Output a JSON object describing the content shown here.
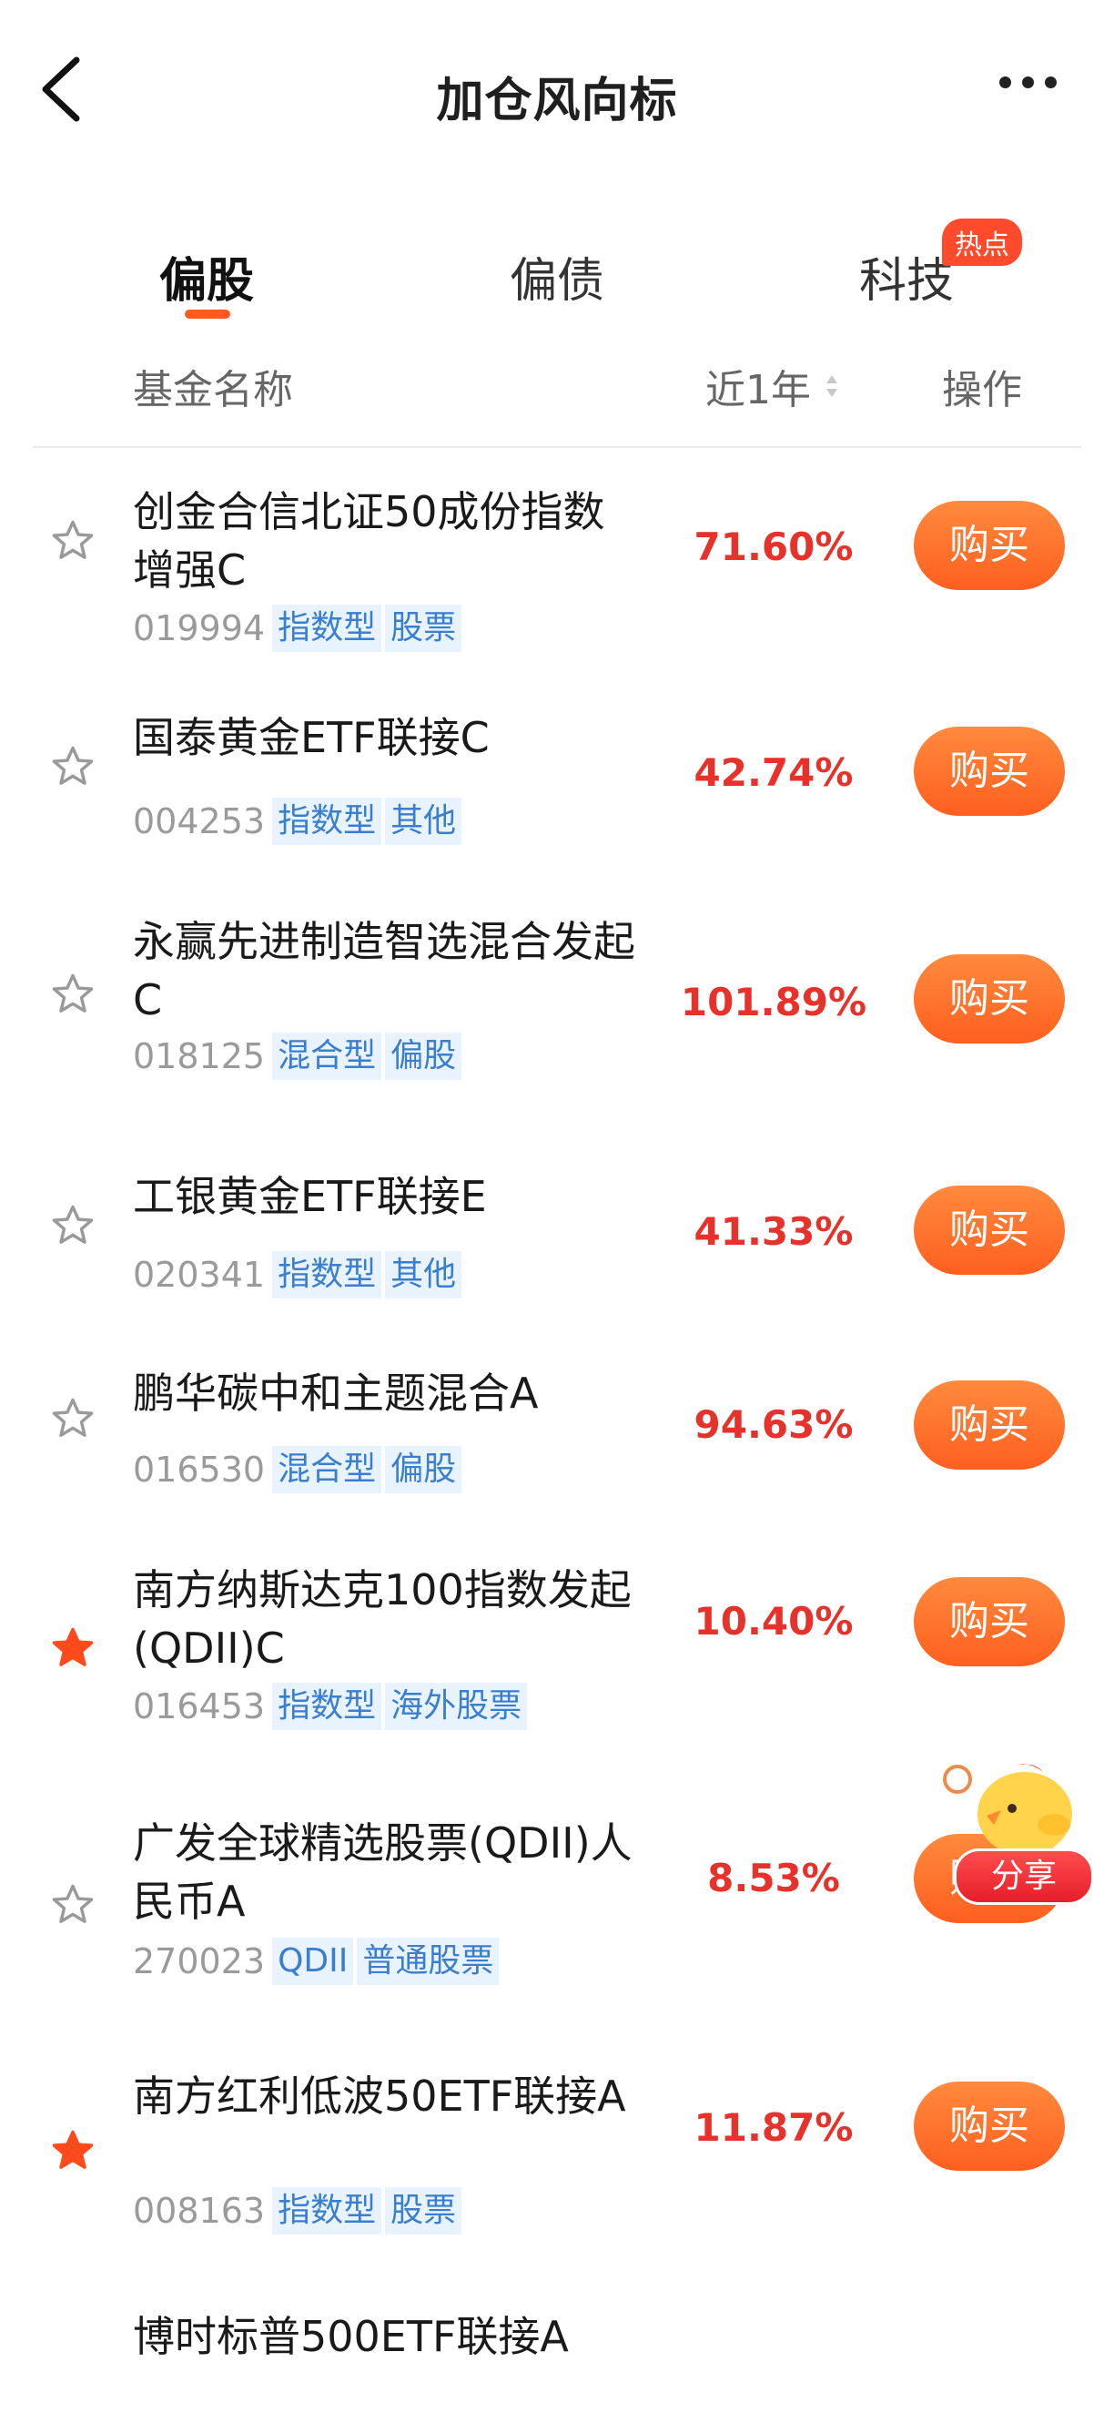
{
  "nav": {
    "title": "加仓风向标"
  },
  "tabs": [
    {
      "label": "偏股",
      "active": true
    },
    {
      "label": "偏债",
      "active": false
    },
    {
      "label": "科技",
      "active": false,
      "badge": "热点"
    }
  ],
  "table_header": {
    "name": "基金名称",
    "period": "近1年",
    "action": "操作"
  },
  "funds": [
    {
      "name": "创金合信北证50成份指数增强C",
      "code": "019994",
      "tags": [
        "指数型",
        "股票"
      ],
      "return": "71.60%",
      "starred": false,
      "button": "购买"
    },
    {
      "name": "国泰黄金ETF联接C",
      "code": "004253",
      "tags": [
        "指数型",
        "其他"
      ],
      "return": "42.74%",
      "starred": false,
      "button": "购买"
    },
    {
      "name": "永赢先进制造智选混合发起C",
      "code": "018125",
      "tags": [
        "混合型",
        "偏股"
      ],
      "return": "101.89%",
      "starred": false,
      "button": "购买"
    },
    {
      "name": "工银黄金ETF联接E",
      "code": "020341",
      "tags": [
        "指数型",
        "其他"
      ],
      "return": "41.33%",
      "starred": false,
      "button": "购买"
    },
    {
      "name": "鹏华碳中和主题混合A",
      "code": "016530",
      "tags": [
        "混合型",
        "偏股"
      ],
      "return": "94.63%",
      "starred": false,
      "button": "购买"
    },
    {
      "name": "南方纳斯达克100指数发起(QDII)C",
      "code": "016453",
      "tags": [
        "指数型",
        "海外股票"
      ],
      "return": "10.40%",
      "starred": true,
      "button": "购买"
    },
    {
      "name": "广发全球精选股票(QDII)人民币A",
      "code": "270023",
      "tags": [
        "QDII",
        "普通股票"
      ],
      "return": "8.53%",
      "starred": false,
      "button": "购买"
    },
    {
      "name": "南方红利低波50ETF联接A",
      "code": "008163",
      "tags": [
        "指数型",
        "股票"
      ],
      "return": "11.87%",
      "starred": true,
      "button": "购买"
    },
    {
      "name": "博时标普500ETF联接A",
      "code": "",
      "tags": [],
      "return": "",
      "starred": false,
      "button": ""
    }
  ],
  "floating": {
    "share_label": "分享"
  },
  "colors": {
    "accent": "#ff5a1f",
    "return_red": "#e6322b",
    "tag_blue": "#3a7fcf",
    "star_active": "#ff4a1c"
  }
}
